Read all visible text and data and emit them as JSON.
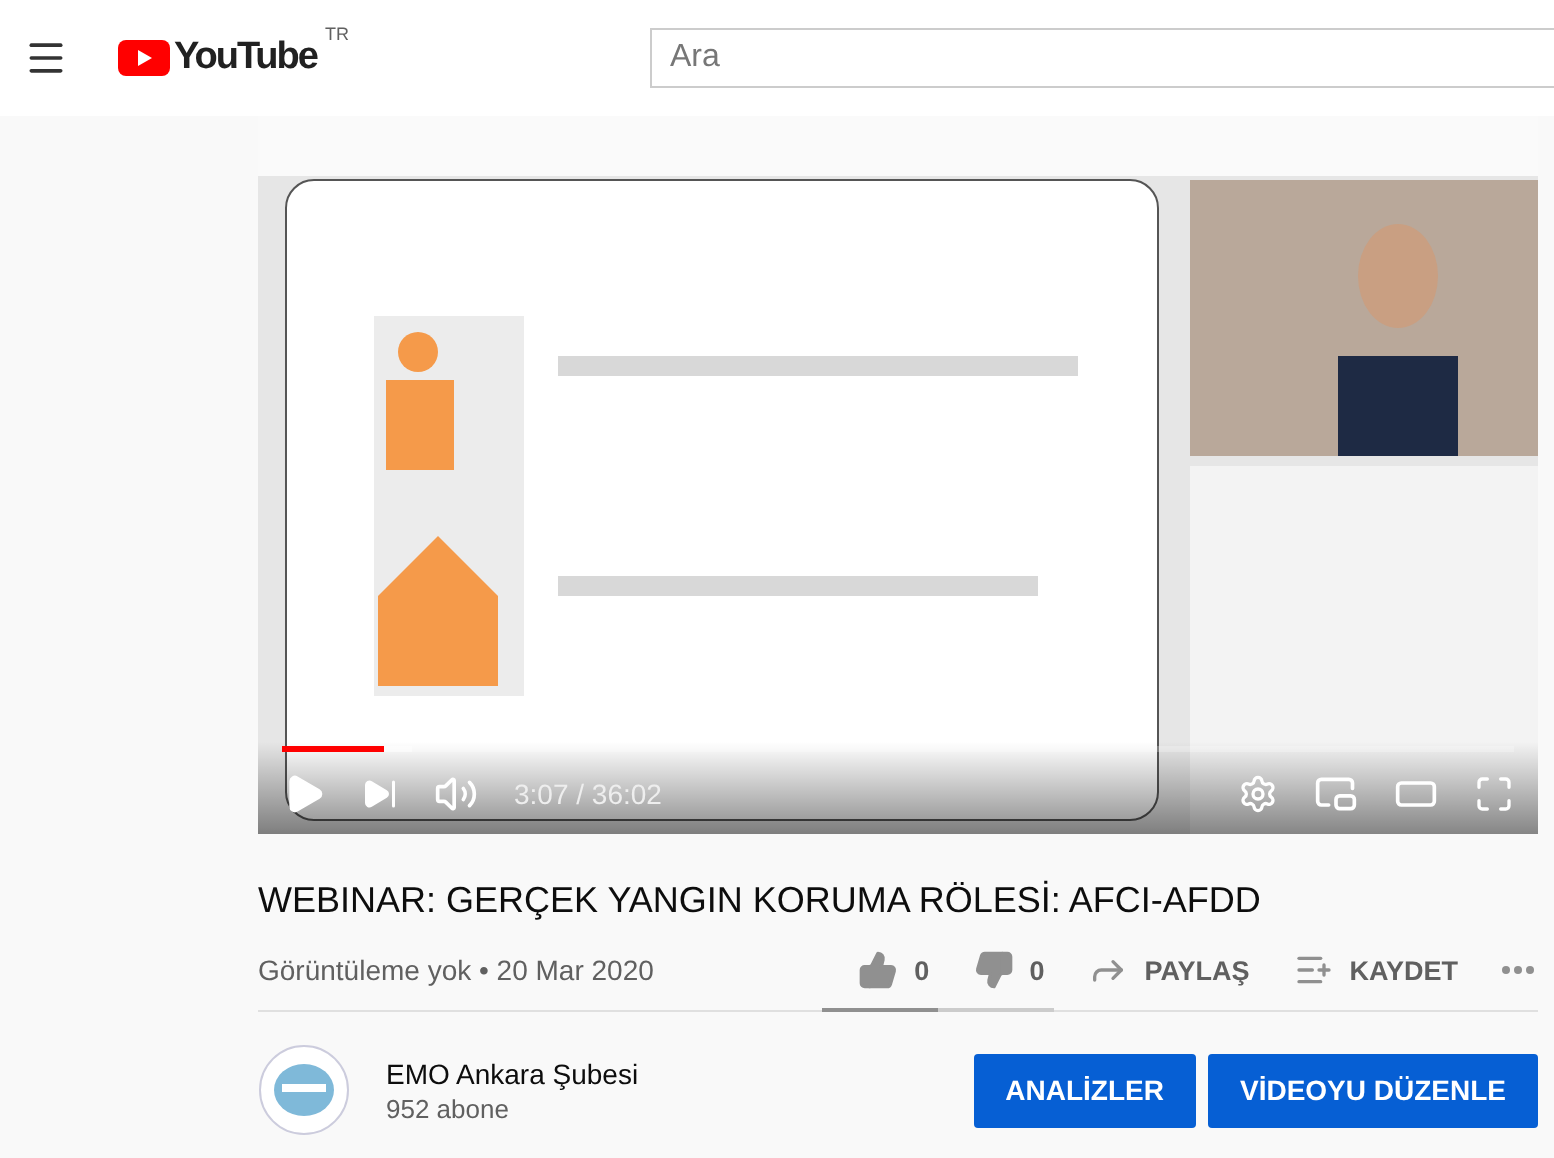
{
  "header": {
    "logo_text": "YouTube",
    "region": "TR",
    "search": {
      "placeholder": "Ara"
    }
  },
  "player": {
    "progress": {
      "level": 0.083,
      "buffered": {
        "level": 0.105
      }
    },
    "time": "3:07 / 36:02"
  },
  "video": {
    "title": "WEBINAR: GERÇEK YANGIN KORUMA RÖLESİ: AFCI-AFDD",
    "meta": "Görüntüleme yok • 20 Mar 2020",
    "actions": [
      {
        "kind": "like",
        "label": "0"
      },
      {
        "kind": "dislike",
        "label": "0"
      },
      {
        "kind": "share",
        "label": "PAYLAŞ"
      },
      {
        "kind": "save",
        "label": "KAYDET"
      },
      {
        "kind": "more"
      }
    ],
    "sentiment": {
      "level": 0.5
    }
  },
  "channel": {
    "name": "EMO Ankara Şubesi",
    "subscribers": "952 abone",
    "buttons": [
      "ANALİZLER",
      "VİDEOYU DÜZENLE"
    ]
  }
}
